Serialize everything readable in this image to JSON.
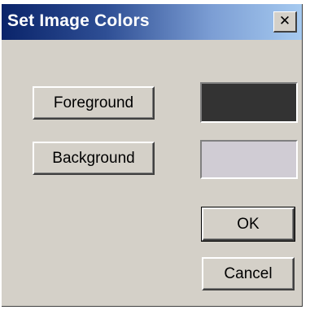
{
  "window": {
    "title": "Set Image Colors",
    "close_label": "✕"
  },
  "buttons": {
    "foreground_label": "Foreground",
    "background_label": "Background",
    "ok_label": "OK",
    "cancel_label": "Cancel"
  },
  "colors": {
    "foreground": "#333333",
    "background": "#d0ccd4",
    "dialog_face": "#d4d0c8",
    "titlebar_start": "#0a246a",
    "titlebar_end": "#a6caf0"
  }
}
